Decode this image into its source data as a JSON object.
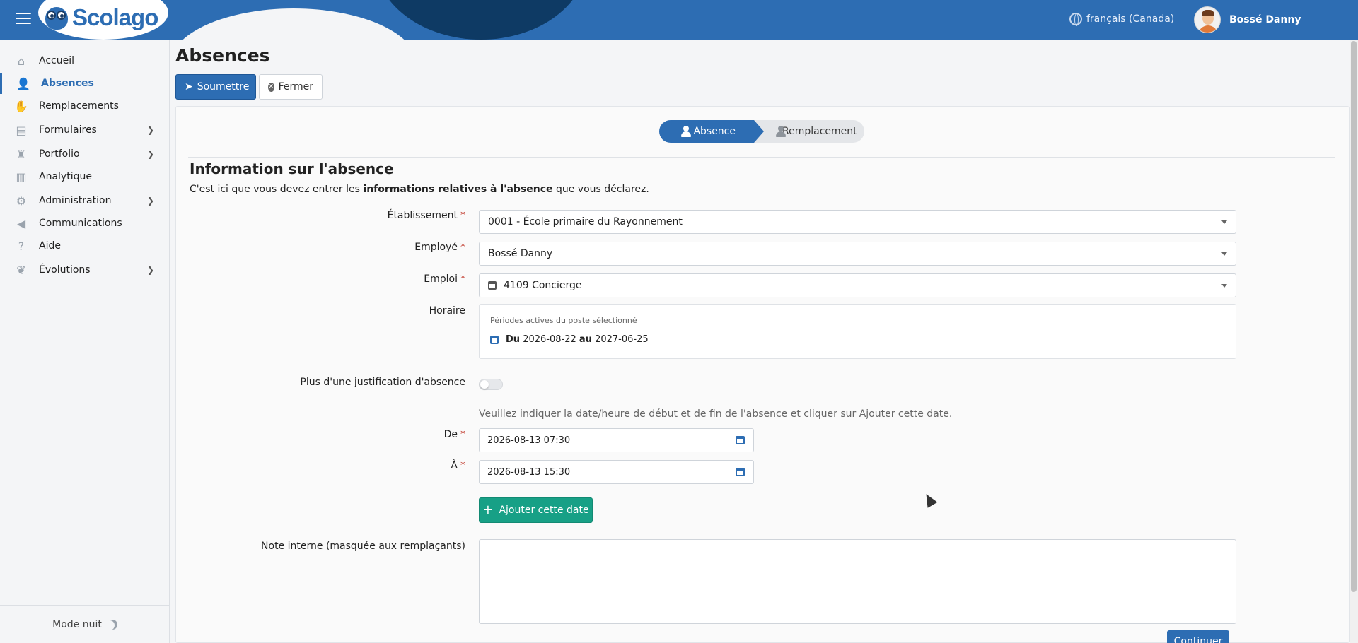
{
  "header": {
    "brand": "Scolago",
    "language": "français (Canada)",
    "user_name": "Bossé Danny"
  },
  "sidebar": {
    "items": [
      {
        "label": "Accueil",
        "icon": "home-icon"
      },
      {
        "label": "Absences",
        "icon": "user-clock-icon",
        "active": true
      },
      {
        "label": "Remplacements",
        "icon": "handshake-icon"
      },
      {
        "label": "Formulaires",
        "icon": "forms-icon",
        "has_submenu": true
      },
      {
        "label": "Portfolio",
        "icon": "trophy-icon",
        "has_submenu": true
      },
      {
        "label": "Analytique",
        "icon": "chart-icon"
      },
      {
        "label": "Administration",
        "icon": "gear-icon",
        "has_submenu": true
      },
      {
        "label": "Communications",
        "icon": "megaphone-icon"
      },
      {
        "label": "Aide",
        "icon": "question-icon"
      },
      {
        "label": "Évolutions",
        "icon": "seedling-icon",
        "has_submenu": true
      }
    ],
    "night_mode": "Mode nuit"
  },
  "page": {
    "title": "Absences",
    "submit_label": "Soumettre",
    "close_label": "Fermer"
  },
  "wizard": {
    "steps": [
      {
        "label": "Absence",
        "active": true
      },
      {
        "label": "Remplacement",
        "active": false
      }
    ]
  },
  "form": {
    "section_title": "Information sur l'absence",
    "desc_before": "C'est ici que vous devez entrer les ",
    "desc_bold": "informations relatives à l'absence",
    "desc_after": " que vous déclarez.",
    "required_mark": "*",
    "etablissement_label": "Établissement",
    "etablissement_value": "0001 - École primaire du Rayonnement",
    "employe_label": "Employé",
    "employe_value": "Bossé Danny",
    "emploi_label": "Emploi",
    "emploi_value": "4109 Concierge",
    "horaire_label": "Horaire",
    "horaire_small": "Périodes actives du poste sélectionné",
    "horaire_du": "Du",
    "horaire_start": "2026-08-22",
    "horaire_au": "au",
    "horaire_end": "2027-06-25",
    "justif_label": "Plus d'une justification d'absence",
    "justif_on": false,
    "date_hint": "Veuillez indiquer la date/heure de début et de fin de l'absence et cliquer sur Ajouter cette date.",
    "de_label": "De",
    "de_value": "2026-08-13 07:30",
    "a_label": "À",
    "a_value": "2026-08-13 15:30",
    "add_date_label": "Ajouter cette date",
    "note_label": "Note interne (masquée aux remplaçants)",
    "note_value": "",
    "continue_label": "Continuer"
  },
  "colors": {
    "primary": "#2d6db3",
    "success": "#17a086",
    "header_dark": "#0e3a64"
  }
}
